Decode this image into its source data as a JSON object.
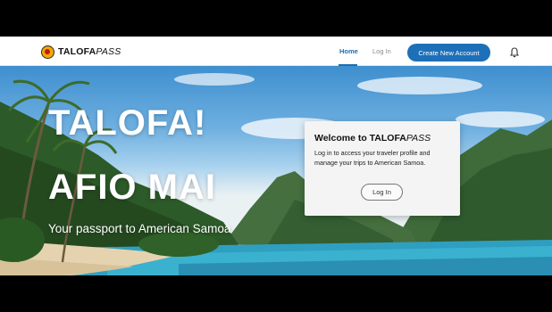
{
  "brand": {
    "name_bold": "TALOFA",
    "name_italic": "PASS",
    "logo_icon": "talofapass-seal-icon"
  },
  "nav": {
    "home_label": "Home",
    "login_label": "Log In",
    "create_account_label": "Create New Account",
    "notifications_icon": "bell-icon",
    "active_tab": "Home"
  },
  "hero": {
    "title_line1": "TALOFA!",
    "title_line2": "AFIO MAI",
    "subtitle": "Your passport to American Samoa"
  },
  "login_card": {
    "title_bold": "Welcome to TALOFA",
    "title_italic": "PASS",
    "body": "Log in to access your traveler profile and manage your trips to American Samoa.",
    "button_label": "Log In"
  },
  "colors": {
    "accent": "#1d6fb8",
    "brand_yellow": "#f2a900",
    "brand_red": "#c4161c"
  }
}
